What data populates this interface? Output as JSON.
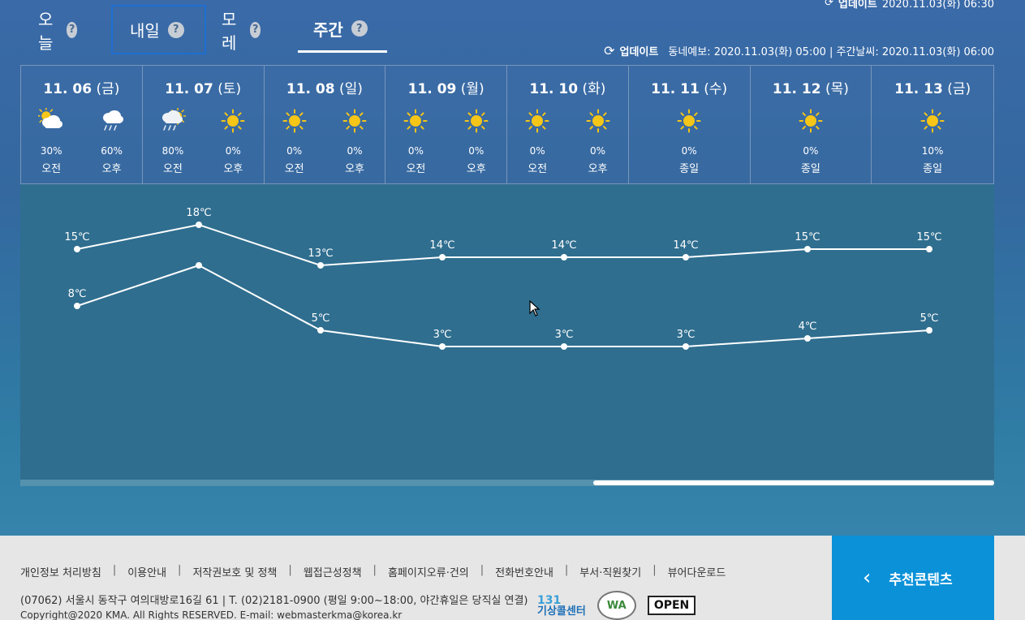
{
  "top_update": {
    "label": "업데이트",
    "time": "2020.11.03(화) 06:30"
  },
  "tabs": [
    {
      "label": "오늘",
      "help": "?"
    },
    {
      "label": "내일",
      "help": "?"
    },
    {
      "label": "모레",
      "help": "?"
    },
    {
      "label": "주간",
      "help": "?"
    }
  ],
  "update": {
    "label": "업데이트",
    "info": "동네예보: 2020.11.03(화) 05:00 | 주간날씨: 2020.11.03(화) 06:00"
  },
  "days": [
    {
      "date": "11. 06",
      "dow": "(금)",
      "slots": [
        {
          "icon": "partly-cloudy-icon",
          "pop": "30%",
          "label": "오전"
        },
        {
          "icon": "rain-icon",
          "pop": "60%",
          "label": "오후"
        }
      ]
    },
    {
      "date": "11. 07",
      "dow": "(토)",
      "slots": [
        {
          "icon": "rain-sun-icon",
          "pop": "80%",
          "label": "오전"
        },
        {
          "icon": "sun-icon",
          "pop": "0%",
          "label": "오후"
        }
      ]
    },
    {
      "date": "11. 08",
      "dow": "(일)",
      "slots": [
        {
          "icon": "sun-icon",
          "pop": "0%",
          "label": "오전"
        },
        {
          "icon": "sun-icon",
          "pop": "0%",
          "label": "오후"
        }
      ]
    },
    {
      "date": "11. 09",
      "dow": "(월)",
      "slots": [
        {
          "icon": "sun-icon",
          "pop": "0%",
          "label": "오전"
        },
        {
          "icon": "sun-icon",
          "pop": "0%",
          "label": "오후"
        }
      ]
    },
    {
      "date": "11. 10",
      "dow": "(화)",
      "slots": [
        {
          "icon": "sun-icon",
          "pop": "0%",
          "label": "오전"
        },
        {
          "icon": "sun-icon",
          "pop": "0%",
          "label": "오후"
        }
      ]
    },
    {
      "date": "11. 11",
      "dow": "(수)",
      "slots": [
        {
          "icon": "sun-icon",
          "pop": "0%",
          "label": "종일"
        }
      ]
    },
    {
      "date": "11. 12",
      "dow": "(목)",
      "slots": [
        {
          "icon": "sun-icon",
          "pop": "0%",
          "label": "종일"
        }
      ]
    },
    {
      "date": "11. 13",
      "dow": "(금)",
      "slots": [
        {
          "icon": "sun-icon",
          "pop": "10%",
          "label": "종일"
        }
      ]
    }
  ],
  "chart_data": {
    "type": "line",
    "x": [
      "11.06",
      "11.07",
      "11.08",
      "11.09",
      "11.10",
      "11.11",
      "11.12",
      "11.13"
    ],
    "series": [
      {
        "values": [
          15,
          18,
          13,
          14,
          14,
          14,
          15,
          15
        ],
        "labels": [
          "15℃",
          "18℃",
          "13℃",
          "14℃",
          "14℃",
          "14℃",
          "15℃",
          "15℃"
        ]
      },
      {
        "values": [
          8,
          13,
          5,
          3,
          3,
          3,
          4,
          5
        ],
        "labels": [
          "8℃",
          "",
          "5℃",
          "3℃",
          "3℃",
          "3℃",
          "4℃",
          "5℃"
        ]
      }
    ],
    "colors": {
      "line": "#ffffff"
    }
  },
  "footer": {
    "links": [
      "개인정보 처리방침",
      "이용안내",
      "저작권보호 및 정책",
      "웹접근성정책",
      "홈페이지오류·건의",
      "전화번호안내",
      "부서·직원찾기",
      "뷰어다운로드"
    ],
    "address": "(07062) 서울시 동작구 여의대방로16길 61 | T. (02)2181-0900 (평일 9:00~18:00, 야간휴일은 당직실 연결)",
    "copyright": "Copyright@2020 KMA. All Rights RESERVED. E-mail: webmasterkma@korea.kr",
    "logo_131_num": "131",
    "logo_131_text": "기상콜센터",
    "logo_wa": "WA",
    "logo_open": "OPEN"
  },
  "recommend": {
    "chevron": "‹",
    "label": "추천콘텐츠"
  }
}
